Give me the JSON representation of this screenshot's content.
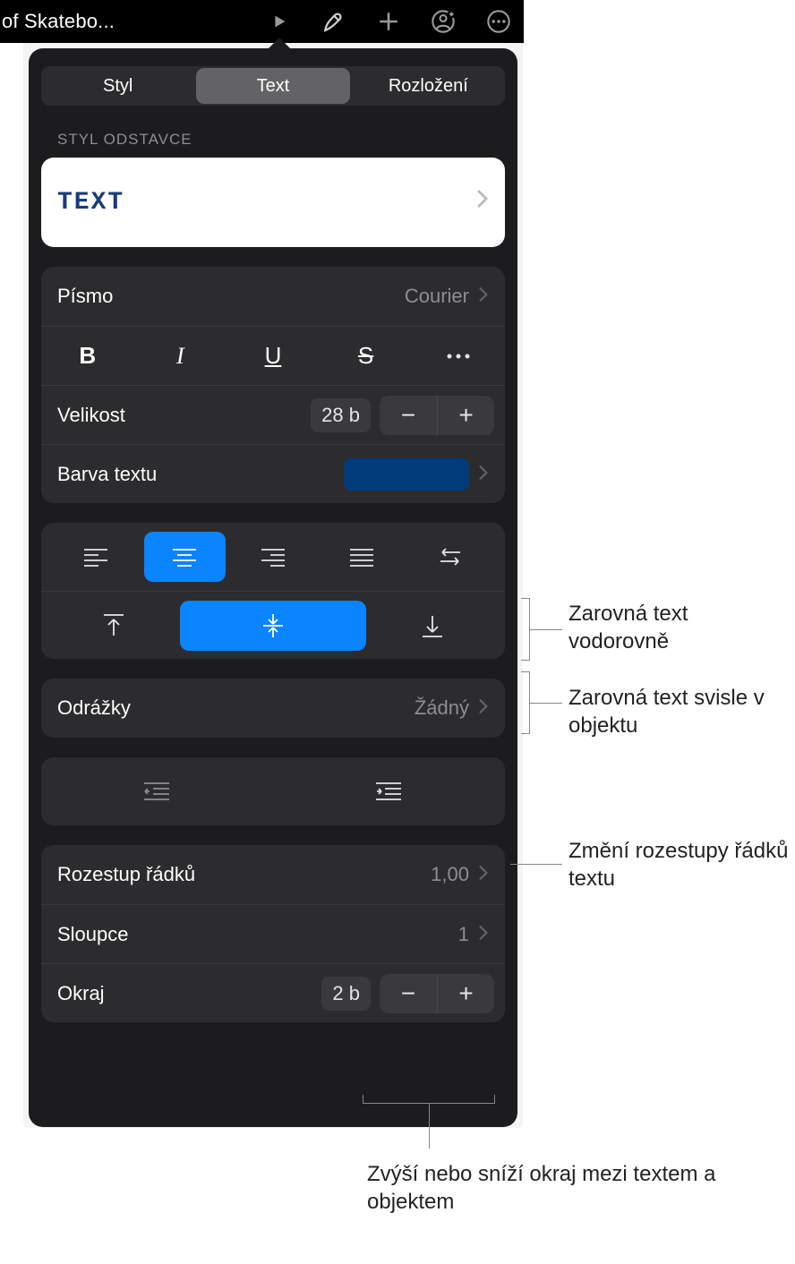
{
  "toolbar": {
    "doc_title": "of Skatebo..."
  },
  "tabs": {
    "style": "Styl",
    "text": "Text",
    "layout": "Rozložení"
  },
  "paragraph_style": {
    "section_label": "STYL ODSTAVCE",
    "value": "TEXT"
  },
  "font": {
    "label": "Písmo",
    "value": "Courier"
  },
  "size": {
    "label": "Velikost",
    "value": "28 b"
  },
  "text_color": {
    "label": "Barva textu",
    "value_hex": "#003b7a"
  },
  "bullets": {
    "label": "Odrážky",
    "value": "Žádný"
  },
  "line_spacing": {
    "label": "Rozestup řádků",
    "value": "1,00"
  },
  "columns": {
    "label": "Sloupce",
    "value": "1"
  },
  "margin": {
    "label": "Okraj",
    "value": "2 b"
  },
  "callouts": {
    "h_align": "Zarovná text vodorovně",
    "v_align": "Zarovná text svisle v objektu",
    "line_gap": "Změní rozestupy řádků textu",
    "margin": "Zvýší nebo sníží okraj mezi textem a objektem"
  }
}
